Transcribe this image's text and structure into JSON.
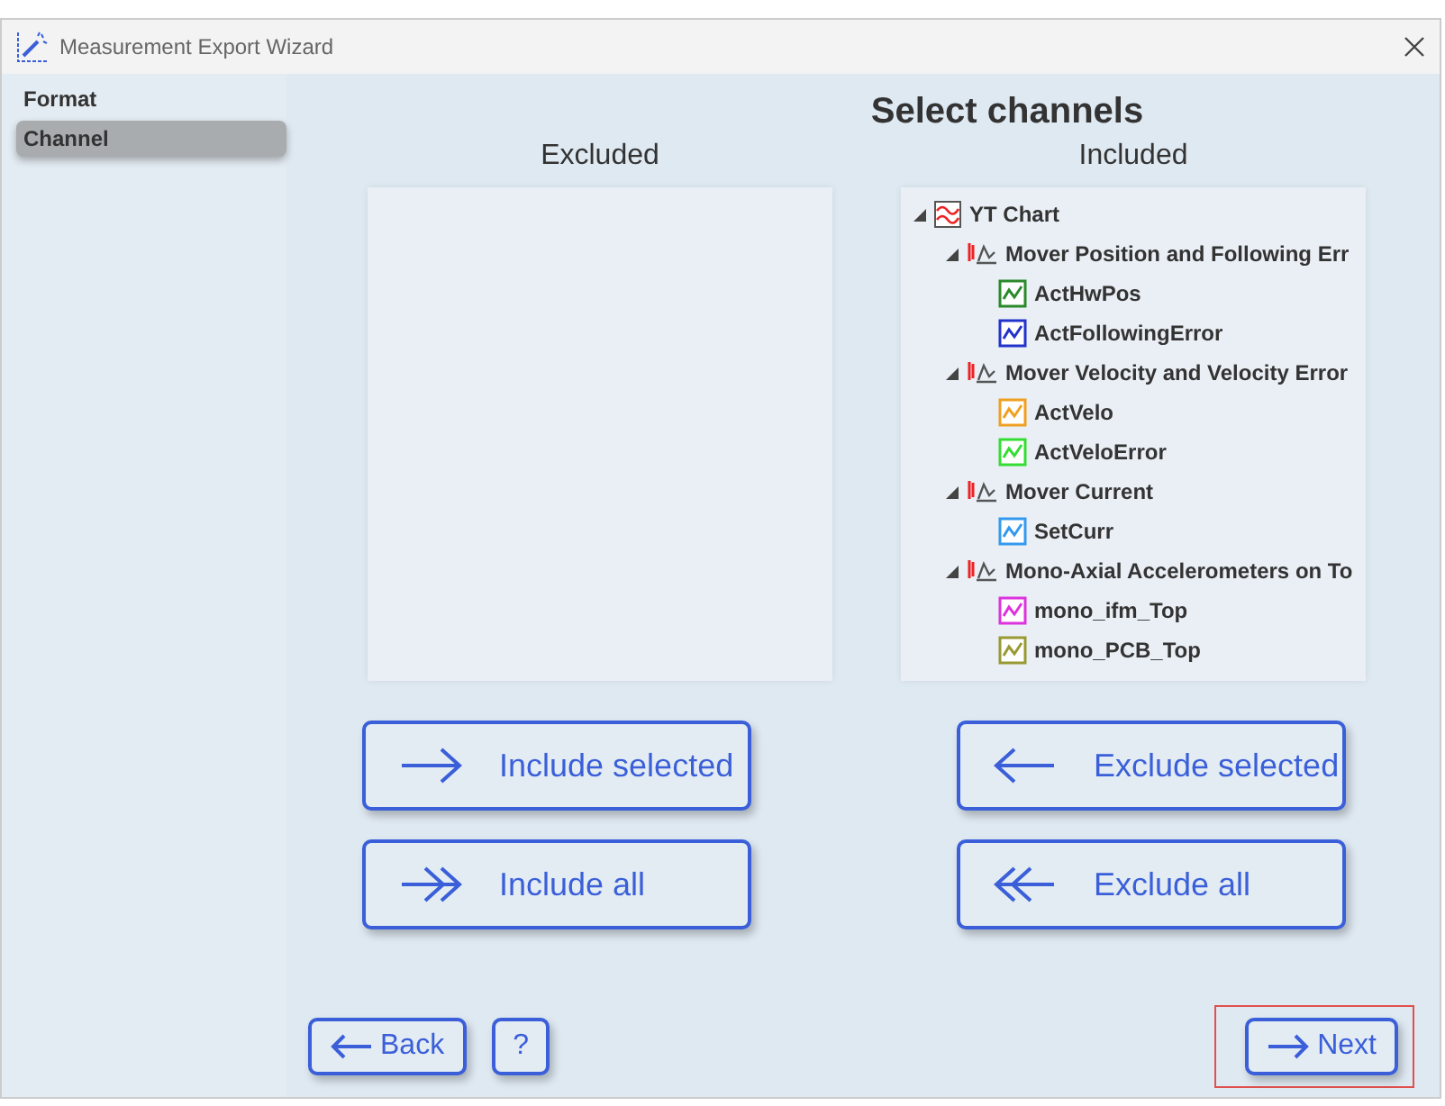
{
  "window": {
    "title": "Measurement Export Wizard"
  },
  "sidebar": {
    "items": [
      {
        "label": "Format",
        "selected": false
      },
      {
        "label": "Channel",
        "selected": true
      }
    ]
  },
  "page_title": "Select channels",
  "excluded": {
    "heading": "Excluded"
  },
  "included": {
    "heading": "Included",
    "tree": [
      {
        "label": "YT Chart",
        "kind": "chart",
        "expanded": true,
        "children": [
          {
            "label": "Mover Position and Following Err",
            "kind": "group",
            "expanded": true,
            "children": [
              {
                "label": "ActHwPos",
                "kind": "series",
                "color": "#2a8a2a"
              },
              {
                "label": "ActFollowingError",
                "kind": "series",
                "color": "#2233cc"
              }
            ]
          },
          {
            "label": "Mover Velocity and Velocity Error",
            "kind": "group",
            "expanded": true,
            "children": [
              {
                "label": "ActVelo",
                "kind": "series",
                "color": "#f0a020"
              },
              {
                "label": "ActVeloError",
                "kind": "series",
                "color": "#33dd33"
              }
            ]
          },
          {
            "label": "Mover Current",
            "kind": "group",
            "expanded": true,
            "children": [
              {
                "label": "SetCurr",
                "kind": "series",
                "color": "#3399ee"
              }
            ]
          },
          {
            "label": "Mono-Axial Accelerometers on To",
            "kind": "group",
            "expanded": true,
            "children": [
              {
                "label": "mono_ifm_Top",
                "kind": "series",
                "color": "#dd33dd"
              },
              {
                "label": "mono_PCB_Top",
                "kind": "series",
                "color": "#999933"
              }
            ]
          }
        ]
      }
    ]
  },
  "transfer_buttons": [
    {
      "label": "Include selected",
      "kind": "right"
    },
    {
      "label": "Exclude selected",
      "kind": "left"
    },
    {
      "label": "Include all",
      "kind": "double-right"
    },
    {
      "label": "Exclude all",
      "kind": "double-left"
    }
  ],
  "footer": {
    "back": "Back",
    "help": "?",
    "next": "Next",
    "next_highlighted": true
  }
}
